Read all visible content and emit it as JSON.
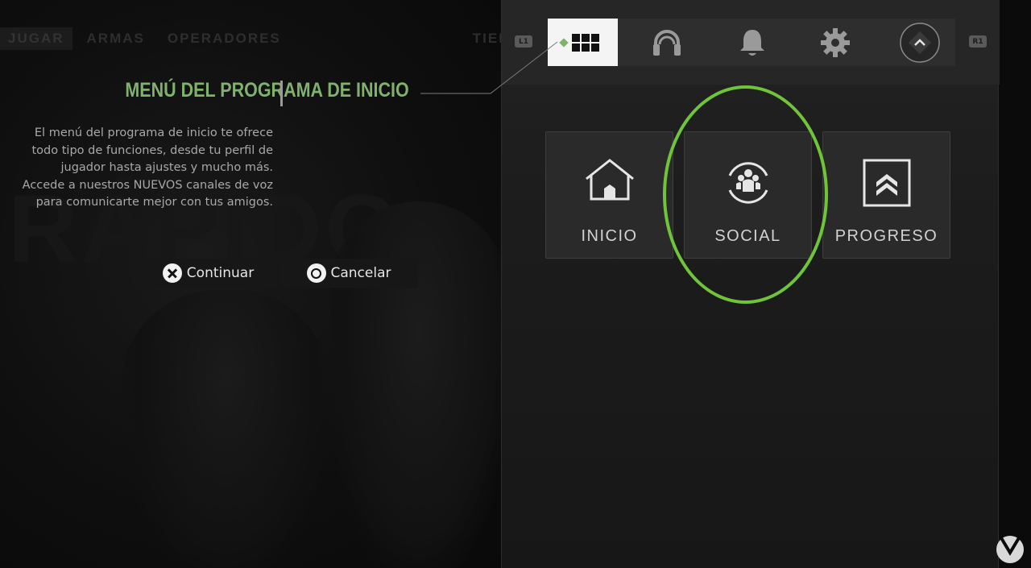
{
  "nav": {
    "tabs": [
      "JUGAR",
      "ARMAS",
      "OPERADORES",
      "TIENDA"
    ]
  },
  "background_text": "RÁPIDO",
  "tutorial": {
    "title": "MENÚ DEL PROGRAMA DE INICIO",
    "body": "El menú del programa de inicio te ofrece todo tipo de funciones, desde tu perfil de jugador hasta ajustes y mucho más. Accede a nuestros NUEVOS canales de voz para comunicarte mejor con tus amigos.",
    "continue_label": "Continuar",
    "cancel_label": "Cancelar"
  },
  "panel": {
    "bumper_left": "L1",
    "bumper_right": "R1",
    "tabs": [
      {
        "icon": "grid-icon",
        "selected": true
      },
      {
        "icon": "headset-icon"
      },
      {
        "icon": "bell-icon"
      },
      {
        "icon": "gear-icon"
      },
      {
        "icon": "profile-chevron-icon"
      }
    ],
    "tiles": [
      {
        "label": "INICIO",
        "icon": "home-icon"
      },
      {
        "label": "SOCIAL",
        "icon": "social-icon",
        "highlighted": true
      },
      {
        "label": "PROGRESO",
        "icon": "rank-chevron-icon"
      }
    ]
  },
  "colors": {
    "accent_green": "#7fb26c",
    "highlight_ring": "#6fc43a",
    "panel_bg": "#1c1c1c",
    "tile_bg": "#2a2a2a"
  }
}
